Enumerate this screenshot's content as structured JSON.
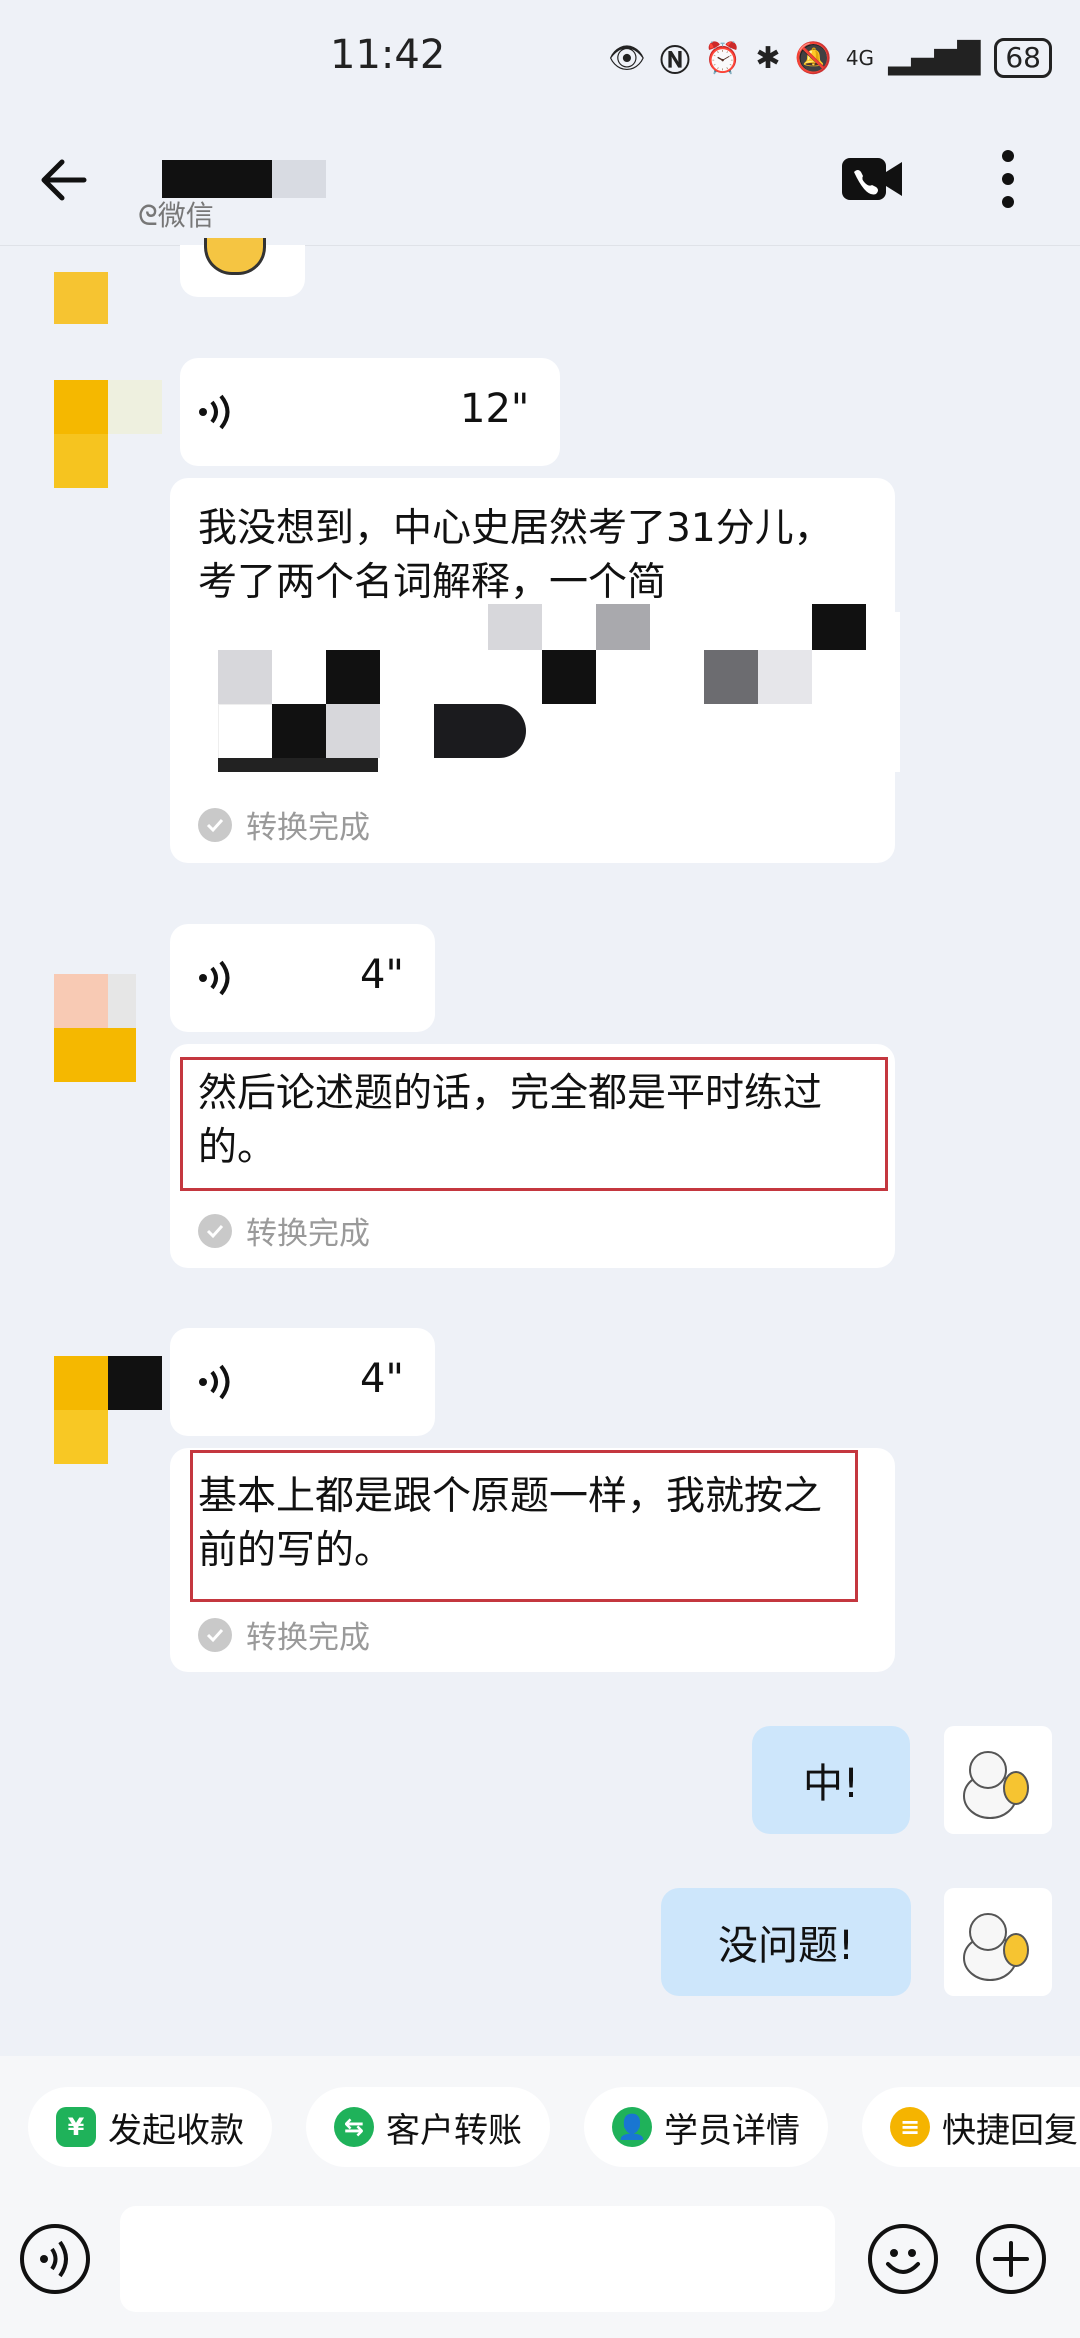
{
  "status_bar": {
    "time": "11:42",
    "network": "4G",
    "battery": "68"
  },
  "header": {
    "source_label": "微信"
  },
  "messages": [
    {
      "side": "left",
      "type": "voice",
      "duration": "12\"",
      "transcript": "我没想到，中心史居然考了31分儿，考了两个名词解释，一个简",
      "status": "转换完成"
    },
    {
      "side": "left",
      "type": "voice",
      "duration": "4\"",
      "transcript": "然后论述题的话，完全都是平时练过的。",
      "status": "转换完成"
    },
    {
      "side": "left",
      "type": "voice",
      "duration": "4\"",
      "transcript": "基本上都是跟个原题一样，我就按之前的写的。",
      "status": "转换完成"
    },
    {
      "side": "right",
      "type": "text",
      "text": "中!"
    },
    {
      "side": "right",
      "type": "text",
      "text": "没问题!"
    }
  ],
  "quick_actions": [
    {
      "label": "发起收款",
      "icon": "yen-shield-icon",
      "color": "#1fb25a"
    },
    {
      "label": "客户转账",
      "icon": "transfer-icon",
      "color": "#1fb25a"
    },
    {
      "label": "学员详情",
      "icon": "user-detail-icon",
      "color": "#1fb25a"
    },
    {
      "label": "快捷回复",
      "icon": "quick-reply-icon",
      "color": "#f5b400"
    }
  ],
  "colors": {
    "highlight": "#c4373f",
    "my_bubble": "#cde6fb",
    "background": "#eef1f7"
  }
}
